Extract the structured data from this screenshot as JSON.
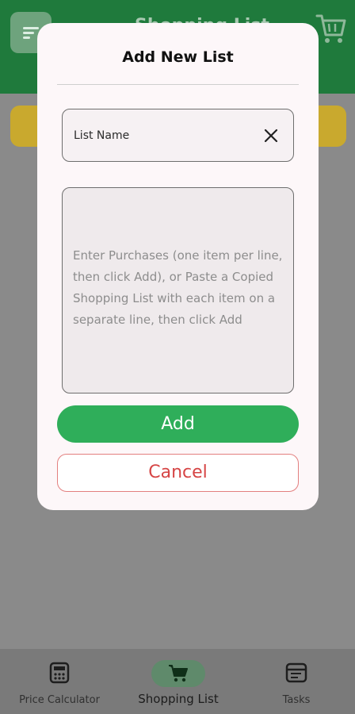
{
  "app": {
    "title": "Shopping List"
  },
  "dialog": {
    "title": "Add New List",
    "list_name_placeholder": "List Name",
    "items_placeholder": "Enter Purchases (one item per line, then click Add), or Paste a Copied Shopping List with each item on a separate line, then click Add",
    "add_label": "Add",
    "cancel_label": "Cancel"
  },
  "bottom_nav": {
    "items": [
      {
        "label": "Price Calculator",
        "icon": "calculator-icon"
      },
      {
        "label": "Shopping List",
        "icon": "cart-icon",
        "active": true
      },
      {
        "label": "Tasks",
        "icon": "tasks-icon"
      }
    ]
  },
  "colors": {
    "primary_green": "#2fae5a",
    "appbar_green": "#1f7a3c",
    "cancel_red": "#d64545",
    "accent_yellow": "#c9a92e"
  }
}
